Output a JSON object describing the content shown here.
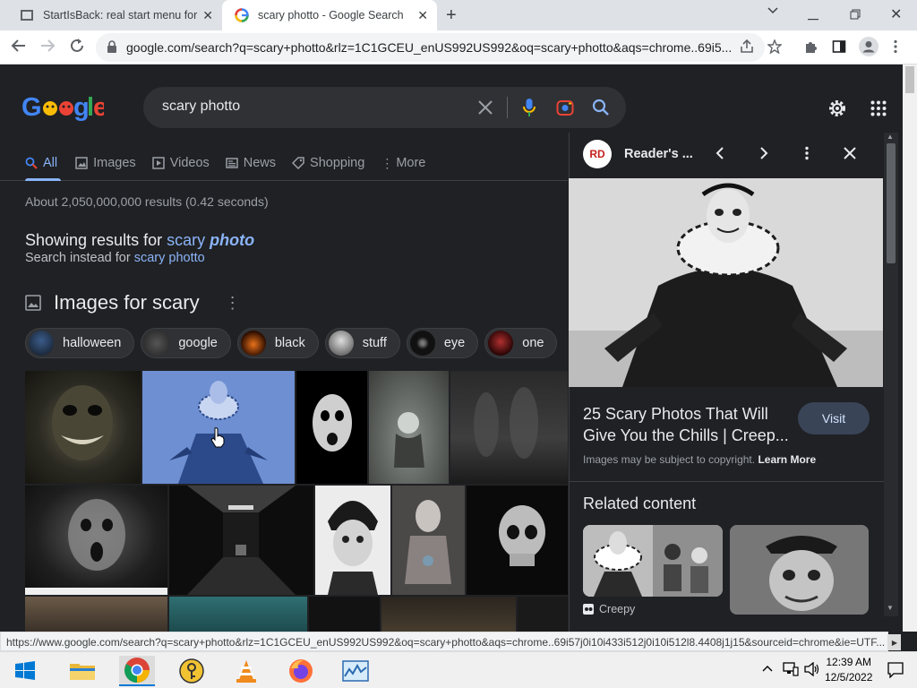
{
  "browser": {
    "tabs": [
      {
        "title": "StartIsBack: real start menu for W",
        "active": false
      },
      {
        "title": "scary photto - Google Search",
        "active": true
      }
    ],
    "url": "google.com/search?q=scary+photto&rlz=1C1GCEU_enUS992US992&oq=scary+photto&aqs=chrome..69i5..."
  },
  "search": {
    "query": "scary photto",
    "tabs": [
      "All",
      "Images",
      "Videos",
      "News",
      "Shopping",
      "More"
    ],
    "results_count": "About 2,050,000,000 results (0.42 seconds)",
    "showing_prefix": "Showing results for ",
    "showing_link": "scary ",
    "showing_link_bold": "photo",
    "instead_prefix": "Search instead for ",
    "instead_link": "scary photto"
  },
  "images_section": {
    "title": "Images for scary",
    "chips": [
      "halloween",
      "google",
      "black",
      "stuff",
      "eye",
      "one"
    ]
  },
  "panel": {
    "source_name": "Reader's ...",
    "source_logo": "RD",
    "title": "25 Scary Photos That Will Give You the Chills | Creep...",
    "visit_label": "Visit",
    "copyright_text": "Images may be subject to copyright. ",
    "learn_more": "Learn More",
    "related_heading": "Related content",
    "related_caption": "Creepy"
  },
  "statusbar": {
    "url": "https://www.google.com/search?q=scary+photto&rlz=1C1GCEU_enUS992US992&oq=scary+photto&aqs=chrome..69i57j0i10i433i512j0i10i512l8.4408j1j15&sourceid=chrome&ie=UTF..."
  },
  "taskbar": {
    "time": "12:39 AM",
    "date": "12/5/2022"
  },
  "colors": {
    "background": "#202124",
    "link": "#8ab4f8",
    "text": "#e8eaed",
    "muted": "#9aa0a6"
  }
}
